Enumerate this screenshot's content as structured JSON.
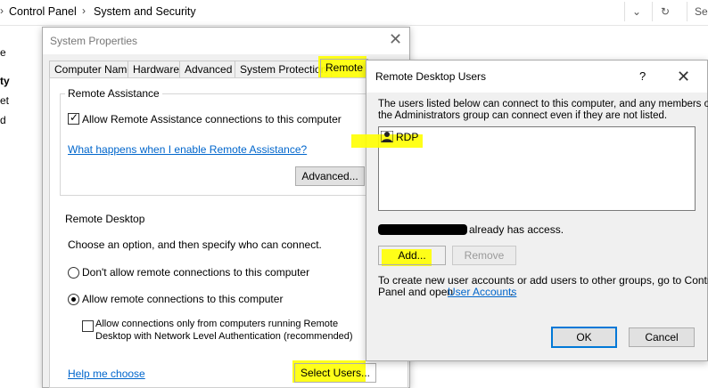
{
  "explorer": {
    "crumbs": [
      "Control Panel",
      "System and Security"
    ],
    "left_fragments": [
      "e",
      "ty",
      "et",
      "d"
    ],
    "search_fragment": "Se"
  },
  "system_properties": {
    "title": "System Properties",
    "tabs": [
      "Computer Name",
      "Hardware",
      "Advanced",
      "System Protection",
      "Remote"
    ],
    "active_tab": "Remote",
    "remote_assistance": {
      "group_title": "Remote Assistance",
      "allow_label": "Allow Remote Assistance connections to this computer",
      "allow_checked": true,
      "help_link": "What happens when I enable Remote Assistance?",
      "advanced_button": "Advanced..."
    },
    "remote_desktop": {
      "group_title": "Remote Desktop",
      "instruction": "Choose an option, and then specify who can connect.",
      "option_dont_allow": "Don't allow remote connections to this computer",
      "option_allow": "Allow remote connections to this computer",
      "selected_option": "allow",
      "nla_label_line1": "Allow connections only from computers running Remote",
      "nla_label_line2": "Desktop with Network Level Authentication (recommended)",
      "nla_checked": false,
      "help_link": "Help me choose",
      "select_users_button": "Select Users..."
    }
  },
  "remote_desktop_users": {
    "title": "Remote Desktop Users",
    "help_glyph": "?",
    "close_glyph": "✕",
    "description_line1": "The users listed below can connect to this computer, and any members of",
    "description_line2": "the Administrators group can connect even if they are not listed.",
    "users": [
      "RDP"
    ],
    "access_text": "already has access.",
    "add_button": "Add...",
    "remove_button": "Remove",
    "footer_line1": "To create new user accounts or add users to other groups, go to Control",
    "footer_line2_prefix": "Panel and open",
    "user_accounts_link": "User Accounts",
    "footer_line2_suffix": ".",
    "ok_button": "OK",
    "cancel_button": "Cancel"
  },
  "colors": {
    "highlight": "#ffff00",
    "link": "#0066cc",
    "default_button_border": "#0078d7"
  }
}
